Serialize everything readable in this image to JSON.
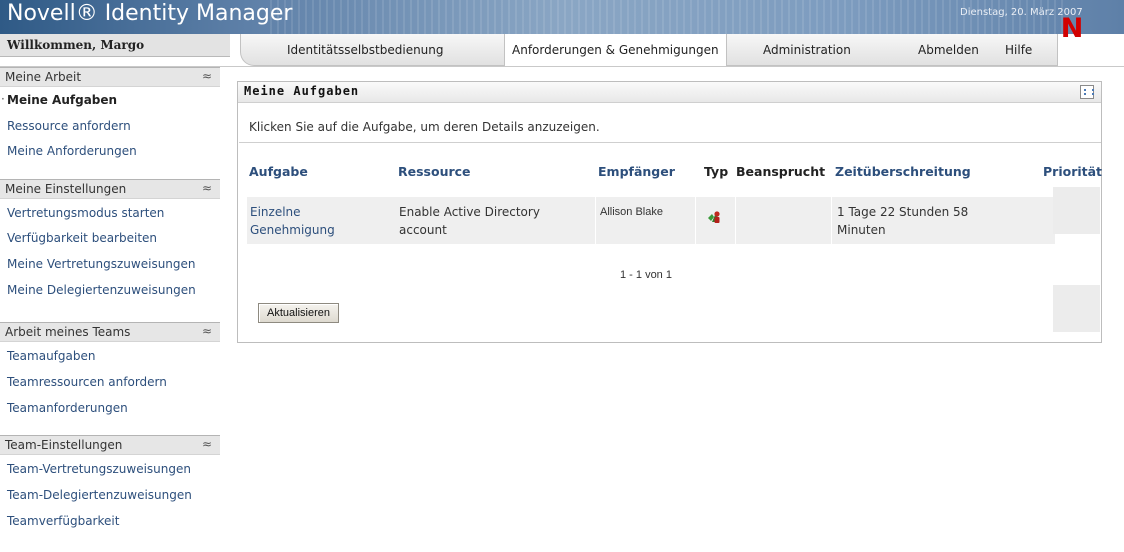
{
  "header": {
    "app_title": "Novell® Identity Manager",
    "date": "Dienstag, 20. März 2007",
    "brand_logo": "N",
    "welcome": "Willkommen, Margo"
  },
  "tabs": [
    {
      "label": "Identitätsselbstbedienung",
      "active": false
    },
    {
      "label": "Anforderungen & Genehmigungen",
      "active": true
    },
    {
      "label": "Administration",
      "active": false
    },
    {
      "label": "Abmelden",
      "active": false
    },
    {
      "label": "Hilfe",
      "active": false
    }
  ],
  "sidebar": {
    "sections": [
      {
        "title": "Meine Arbeit",
        "items": [
          "Meine Aufgaben",
          "Ressource anfordern",
          "Meine Anforderungen"
        ]
      },
      {
        "title": "Meine Einstellungen",
        "items": [
          "Vertretungsmodus starten",
          "Verfügbarkeit bearbeiten",
          "Meine Vertretungszuweisungen",
          "Meine Delegiertenzuweisungen"
        ]
      },
      {
        "title": "Arbeit meines Teams",
        "items": [
          "Teamaufgaben",
          "Teamressourcen anfordern",
          "Teamanforderungen"
        ]
      },
      {
        "title": "Team-Einstellungen",
        "items": [
          "Team-Vertretungszuweisungen",
          "Team-Delegiertenzuweisungen",
          "Teamverfügbarkeit"
        ]
      }
    ],
    "collapse_glyph": "≈",
    "current_marker": "·"
  },
  "panel": {
    "title": "Meine Aufgaben",
    "instruction": "Klicken Sie auf die Aufgabe, um deren Details anzuzeigen.",
    "columns": [
      "Aufgabe",
      "Ressource",
      "Empfänger",
      "Typ",
      "Beansprucht",
      "Zeitüberschreitung",
      "Priorität"
    ],
    "rows": [
      {
        "task_line1": "Einzelne",
        "task_line2": "Genehmigung",
        "resource_line1": "Enable Active Directory",
        "resource_line2": "account",
        "recipient": "Allison Blake",
        "type_icon": "approval-type-icon",
        "claimed": "",
        "timeout_line1": "1 Tage 22 Stunden 58",
        "timeout_line2": "Minuten",
        "priority": ""
      }
    ],
    "paging": "1 - 1 von 1",
    "refresh_label": "Aktualisieren"
  },
  "colors": {
    "link": "#2d4f7c",
    "brand_red": "#d20000",
    "banner_blue": "#5e80a8",
    "row_bg": "#efefef"
  }
}
